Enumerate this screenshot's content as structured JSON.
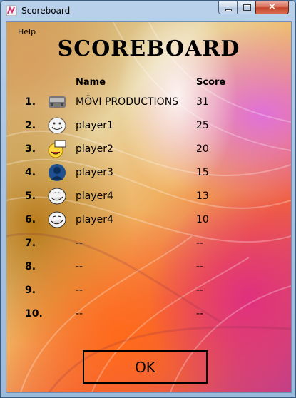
{
  "window": {
    "title": "Scoreboard"
  },
  "menu": {
    "help": "Help"
  },
  "heading": "SCOREBOARD",
  "columns": {
    "name": "Name",
    "score": "Score"
  },
  "rows": [
    {
      "rank": "1.",
      "name": "MÖVI PRODUCTIONS",
      "score": "31",
      "avatar": "movi-logo-icon"
    },
    {
      "rank": "2.",
      "name": "player1",
      "score": "25",
      "avatar": "troll-face-icon"
    },
    {
      "rank": "3.",
      "name": "player2",
      "score": "20",
      "avatar": "lol-face-icon"
    },
    {
      "rank": "4.",
      "name": "player3",
      "score": "15",
      "avatar": "user-silhouette-icon"
    },
    {
      "rank": "5.",
      "name": "player4",
      "score": "13",
      "avatar": "troll-face-icon"
    },
    {
      "rank": "6.",
      "name": "player4",
      "score": "10",
      "avatar": "troll-face-icon"
    },
    {
      "rank": "7.",
      "name": "--",
      "score": "--"
    },
    {
      "rank": "8.",
      "name": "--",
      "score": "--"
    },
    {
      "rank": "9.",
      "name": "--",
      "score": "--"
    },
    {
      "rank": "10.",
      "name": "--",
      "score": "--"
    }
  ],
  "ok_button": "OK",
  "colors": {
    "titlebar": "#b9d1ea",
    "close": "#c5452c"
  }
}
